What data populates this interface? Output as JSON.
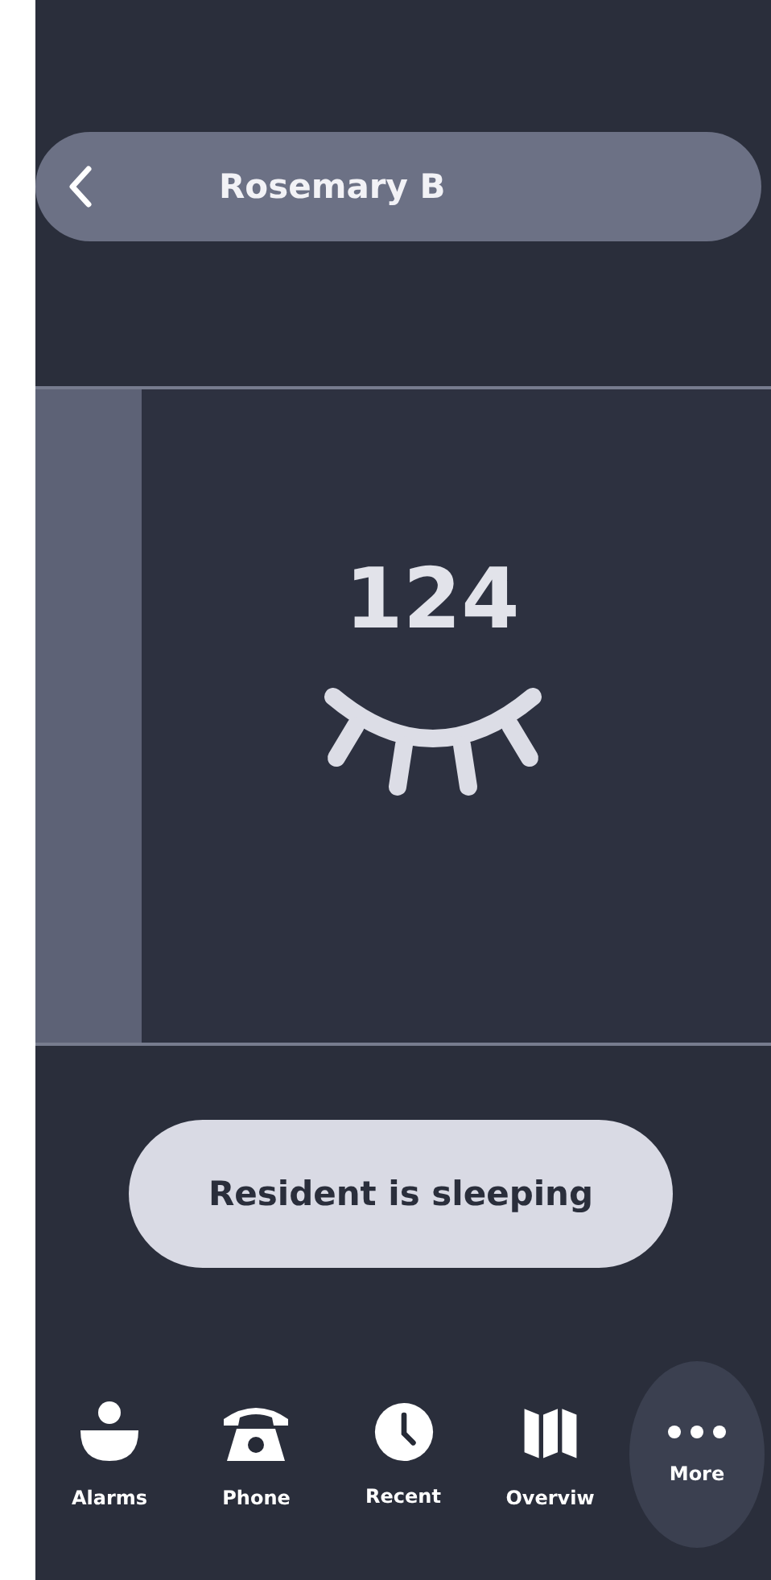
{
  "header": {
    "title": "Rosemary B"
  },
  "room": {
    "number": "124"
  },
  "status": {
    "text": "Resident is sleeping"
  },
  "nav": [
    {
      "label": "Alarms",
      "selected": false
    },
    {
      "label": "Phone",
      "selected": false
    },
    {
      "label": "Recent",
      "selected": false
    },
    {
      "label": "Overviw",
      "selected": false
    },
    {
      "label": "More",
      "selected": true
    }
  ]
}
